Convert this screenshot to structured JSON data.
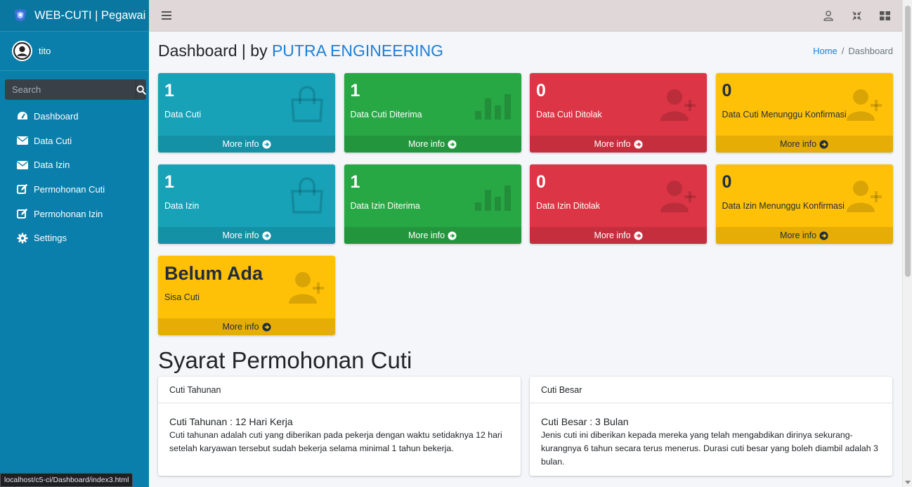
{
  "app": {
    "brand": "WEB-CUTI | Pegawai",
    "user": "tito",
    "search_placeholder": "Search",
    "status_url": "localhost/c5-ci/Dashboard/index3.html"
  },
  "sidebar": {
    "items": [
      {
        "label": "Dashboard",
        "icon": "tachometer-icon"
      },
      {
        "label": "Data Cuti",
        "icon": "envelope-icon"
      },
      {
        "label": "Data Izin",
        "icon": "envelope-icon"
      },
      {
        "label": "Permohonan Cuti",
        "icon": "edit-icon"
      },
      {
        "label": "Permohonan Izin",
        "icon": "edit-icon"
      },
      {
        "label": "Settings",
        "icon": "gear-icon"
      }
    ]
  },
  "header": {
    "title_prefix": "Dashboard | by ",
    "title_accent": "PUTRA ENGINEERING",
    "breadcrumb_home": "Home",
    "breadcrumb_sep": "/",
    "breadcrumb_current": "Dashboard"
  },
  "boxes": [
    {
      "value": "1",
      "label": "Data Cuti",
      "footer": "More info",
      "color": "#17a2b8",
      "icon": "shopping-bag-icon"
    },
    {
      "value": "1",
      "label": "Data Cuti Diterima",
      "footer": "More info",
      "color": "#28a745",
      "icon": "bar-chart-icon"
    },
    {
      "value": "0",
      "label": "Data Cuti Ditolak",
      "footer": "More info",
      "color": "#dc3545",
      "icon": "user-plus-icon"
    },
    {
      "value": "0",
      "label": "Data Cuti Menunggu Konfirmasi",
      "footer": "More info",
      "color": "#ffc107",
      "icon": "user-plus-icon"
    },
    {
      "value": "1",
      "label": "Data Izin",
      "footer": "More info",
      "color": "#17a2b8",
      "icon": "shopping-bag-icon"
    },
    {
      "value": "1",
      "label": "Data Izin Diterima",
      "footer": "More info",
      "color": "#28a745",
      "icon": "bar-chart-icon"
    },
    {
      "value": "0",
      "label": "Data Izin Ditolak",
      "footer": "More info",
      "color": "#dc3545",
      "icon": "user-plus-icon"
    },
    {
      "value": "0",
      "label": "Data Izin Menunggu Konfirmasi",
      "footer": "More info",
      "color": "#ffc107",
      "icon": "user-plus-icon"
    },
    {
      "value": "Belum Ada",
      "label": "Sisa Cuti",
      "footer": "More info",
      "color": "#ffc107",
      "icon": "user-plus-icon"
    }
  ],
  "section": {
    "title": "Syarat Permohonan Cuti"
  },
  "cards": [
    {
      "header": "Cuti Tahunan",
      "subtitle": "Cuti Tahunan : 12 Hari Kerja",
      "text": "Cuti tahunan adalah cuti yang diberikan pada pekerja dengan waktu setidaknya 12 hari setelah karyawan tersebut sudah bekerja selama minimal 1 tahun bekerja."
    },
    {
      "header": "Cuti Besar",
      "subtitle": "Cuti Besar : 3 Bulan",
      "text": "Jenis cuti ini diberikan kepada mereka yang telah mengabdikan dirinya sekurang-kurangnya 6 tahun secara terus menerus. Durasi cuti besar yang boleh diambil adalah 3 bulan."
    }
  ]
}
